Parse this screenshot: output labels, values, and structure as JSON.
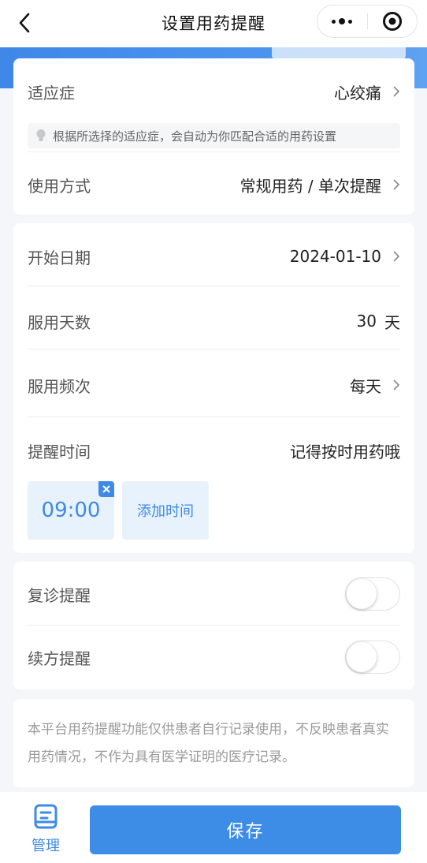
{
  "nav": {
    "title": "设置用药提醒"
  },
  "indication_card": {
    "indication_label": "适应症",
    "indication_value": "心绞痛",
    "tip_text": "根据所选择的适应症，会自动为你匹配合适的用药设置",
    "usage_label": "使用方式",
    "usage_value": "常规用药 / 单次提醒"
  },
  "schedule_card": {
    "start_date_label": "开始日期",
    "start_date_value": "2024-01-10",
    "days_label": "服用天数",
    "days_value": "30",
    "days_unit": "天",
    "frequency_label": "服用频次",
    "frequency_value": "每天",
    "reminder_time_label": "提醒时间",
    "reminder_time_hint": "记得按时用药哦",
    "times": [
      "09:00"
    ],
    "add_time_label": "添加时间"
  },
  "toggles_card": {
    "followup_label": "复诊提醒",
    "followup_on": false,
    "refill_label": "续方提醒",
    "refill_on": false
  },
  "disclaimer": {
    "text": "本平台用药提醒功能仅供患者自行记录使用，不反映患者真实用药情况，不作为具有医学证明的医疗记录。"
  },
  "bottom_bar": {
    "manage_label": "管理",
    "save_label": "保存"
  },
  "colors": {
    "accent": "#3d8ce6",
    "chip_bg": "#e8f2fc",
    "page_bg": "#f4f6f9"
  },
  "icons": [
    "back-arrow-icon",
    "more-dots-icon",
    "target-icon",
    "chevron-right-icon",
    "lightbulb-icon",
    "close-icon",
    "clipboard-icon"
  ]
}
